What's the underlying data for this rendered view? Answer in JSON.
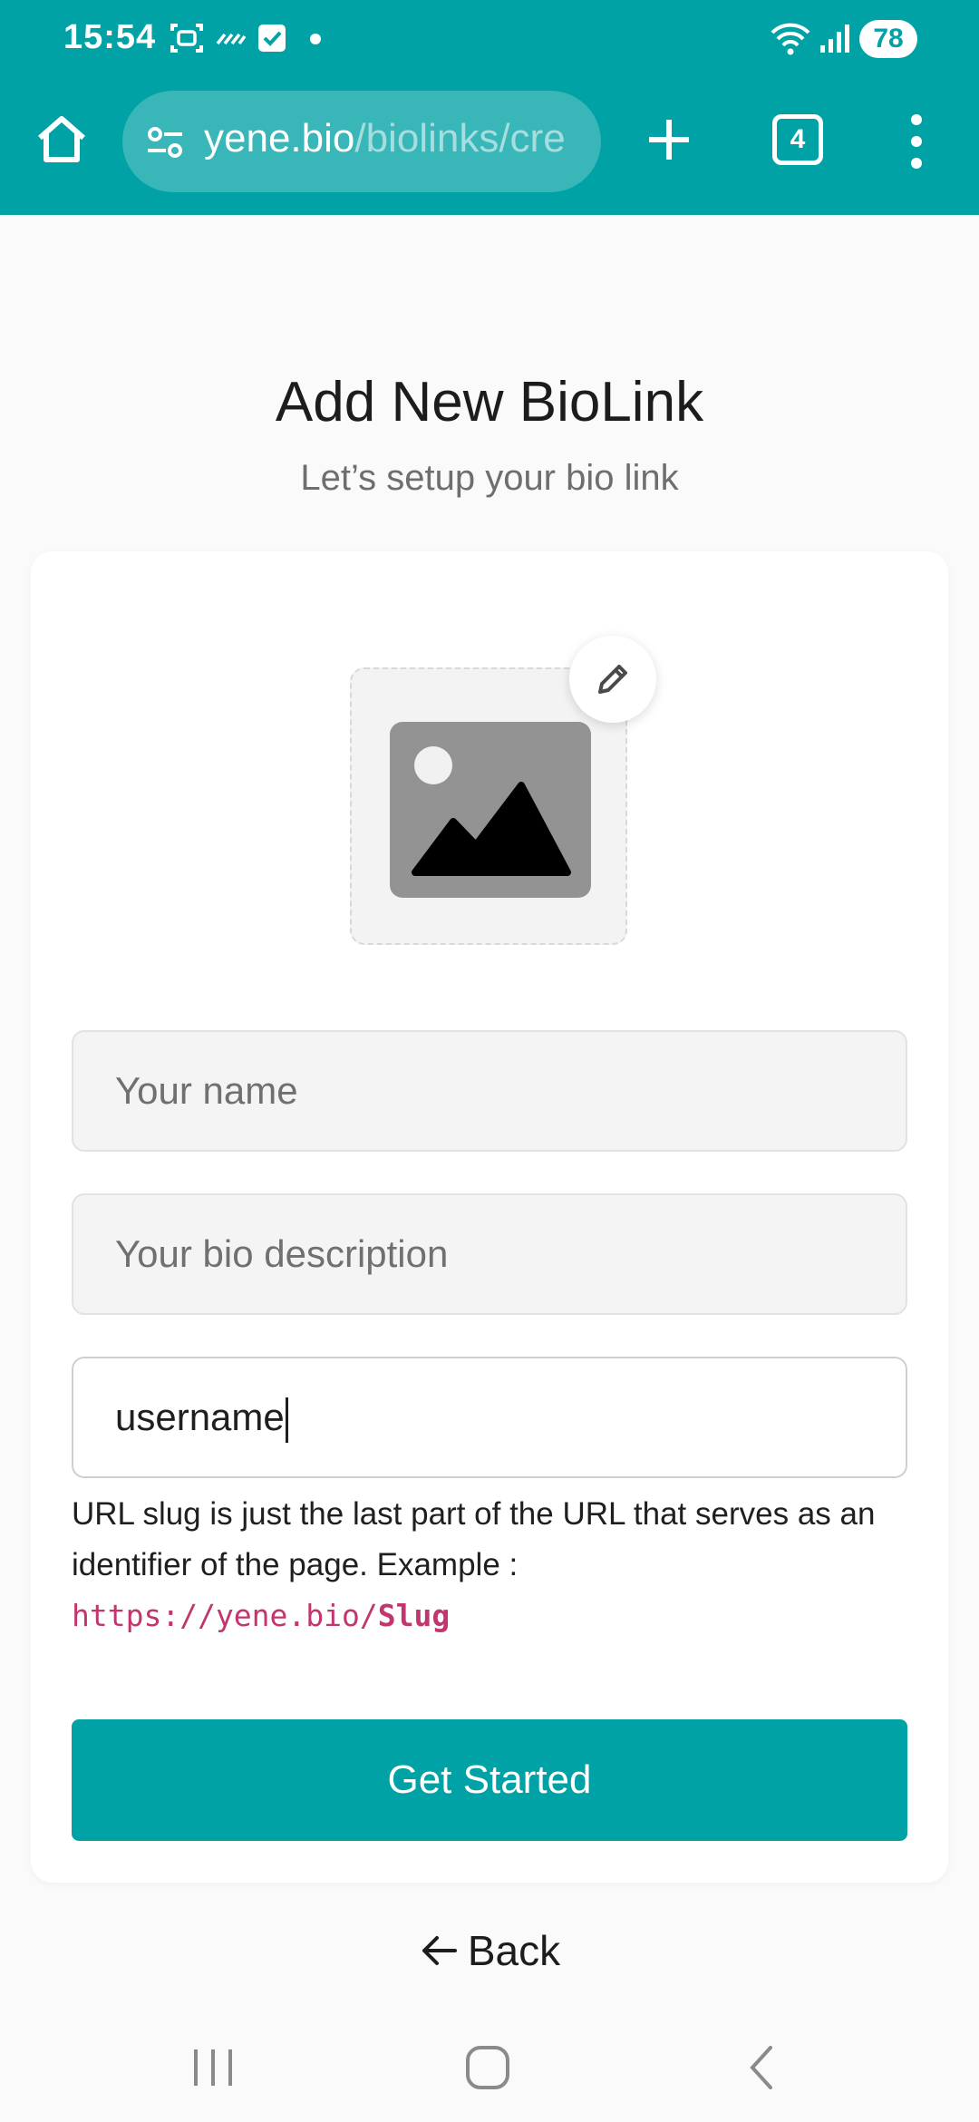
{
  "status_bar": {
    "time": "15:54",
    "battery": "78"
  },
  "browser": {
    "url_domain": "yene.bio",
    "url_path": "/biolinks/cre",
    "tab_count": "4",
    "accent_color": "#00a2a5"
  },
  "page": {
    "title": "Add New BioLink",
    "subtitle": "Let’s setup your bio link"
  },
  "form": {
    "name_placeholder": "Your name",
    "bio_placeholder": "Your bio description",
    "username_value": "username",
    "hint_text": "URL slug is just the last part of the URL that serves as an identifier of the page. Example :",
    "hint_url_base": "https://yene.bio/",
    "hint_url_slug": "Slug",
    "submit_label": "Get Started"
  },
  "footer": {
    "back_label": "Back"
  },
  "icons": {
    "home": "home-icon",
    "site_settings": "tune-icon",
    "new_tab": "plus-icon",
    "tabs": "tabs-count-icon",
    "menu": "more-vert-icon",
    "image_placeholder": "image-icon",
    "edit": "pencil-icon",
    "back": "arrow-left-icon"
  }
}
